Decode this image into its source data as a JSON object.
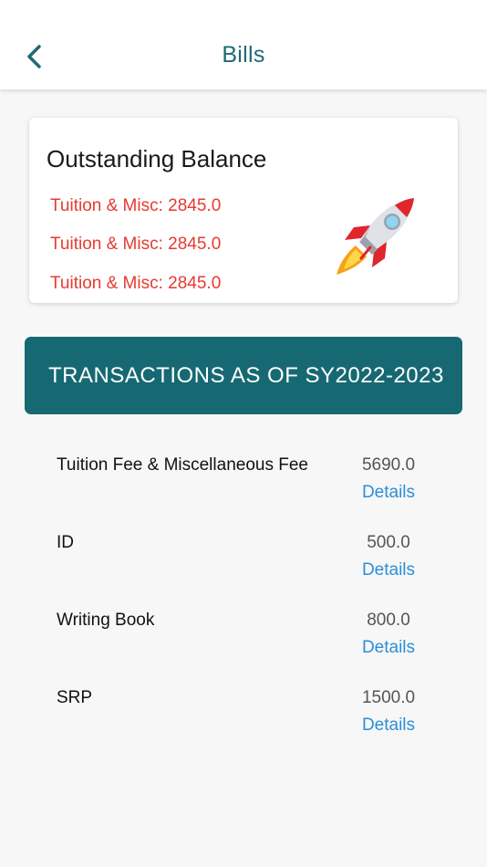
{
  "header": {
    "title": "Bills",
    "back_icon": "chevron-left-icon"
  },
  "balance": {
    "title": "Outstanding Balance",
    "lines": [
      "Tuition & Misc: 2845.0",
      "Tuition & Misc: 2845.0",
      "Tuition & Misc: 2845.0"
    ],
    "icon": "rocket-icon"
  },
  "banner": {
    "text": "TRANSACTIONS AS OF SY2022-2023"
  },
  "transactions": [
    {
      "name": "Tuition Fee & Miscellaneous Fee",
      "amount": "5690.0",
      "details": "Details"
    },
    {
      "name": "ID",
      "amount": "500.0",
      "details": "Details"
    },
    {
      "name": "Writing Book",
      "amount": "800.0",
      "details": "Details"
    },
    {
      "name": "SRP",
      "amount": "1500.0",
      "details": "Details"
    }
  ],
  "colors": {
    "accent": "#166972",
    "balance_text": "#e8392f",
    "link": "#2b8fd6",
    "title": "#1e6a75"
  }
}
